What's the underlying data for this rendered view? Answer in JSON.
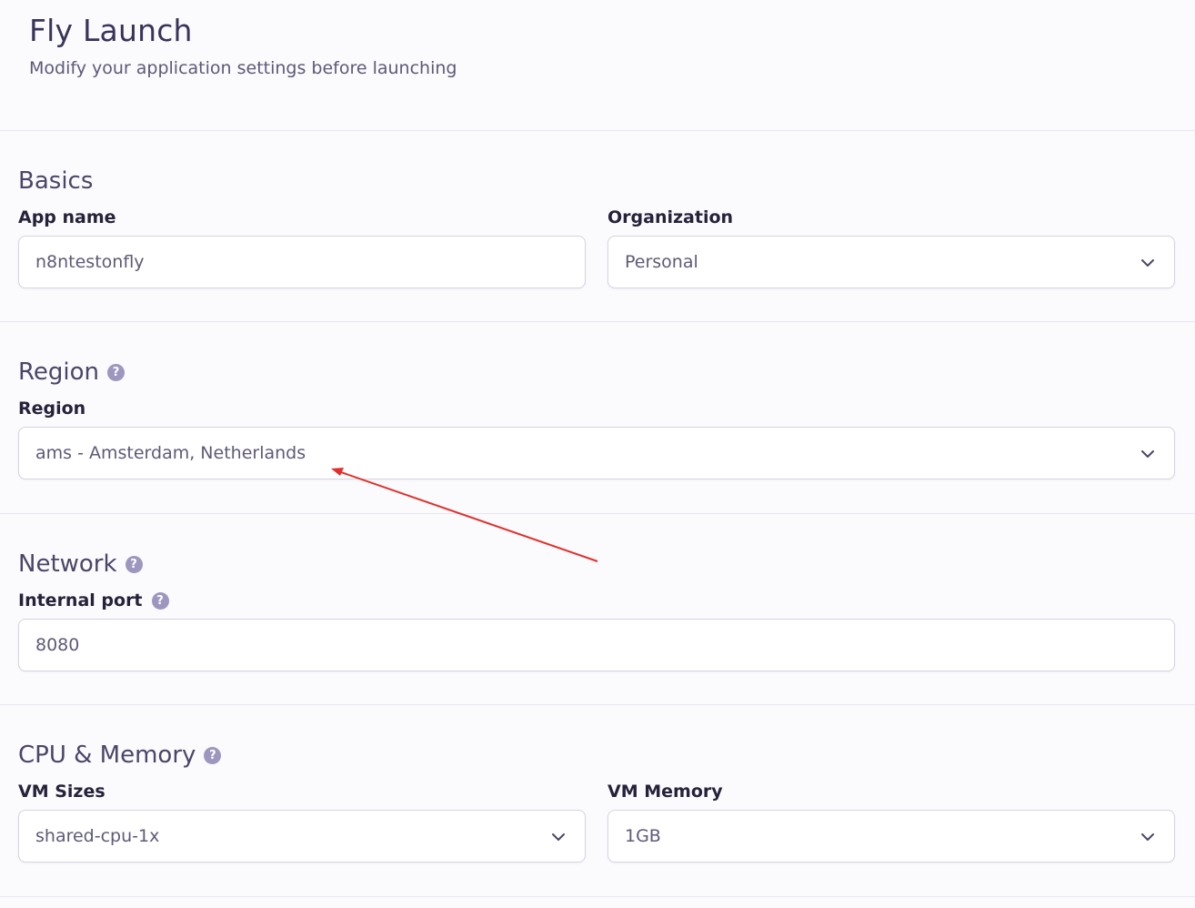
{
  "header": {
    "title": "Fly Launch",
    "subtitle": "Modify your application settings before launching"
  },
  "basics": {
    "title": "Basics",
    "app_name": {
      "label": "App name",
      "value": "n8ntestonfly"
    },
    "organization": {
      "label": "Organization",
      "value": "Personal"
    }
  },
  "region": {
    "title": "Region",
    "field": {
      "label": "Region",
      "value": "ams - Amsterdam, Netherlands"
    }
  },
  "network": {
    "title": "Network",
    "internal_port": {
      "label": "Internal port",
      "value": "8080"
    }
  },
  "cpu_memory": {
    "title": "CPU & Memory",
    "vm_sizes": {
      "label": "VM Sizes",
      "value": "shared-cpu-1x"
    },
    "vm_memory": {
      "label": "VM Memory",
      "value": "1GB"
    }
  },
  "icons": {
    "help": "question-circle-icon",
    "select": "chevron-down-icon"
  },
  "help_glyph": "?",
  "colors": {
    "accent_help": "#9d97bf",
    "annotation_arrow": "#e0302a"
  }
}
